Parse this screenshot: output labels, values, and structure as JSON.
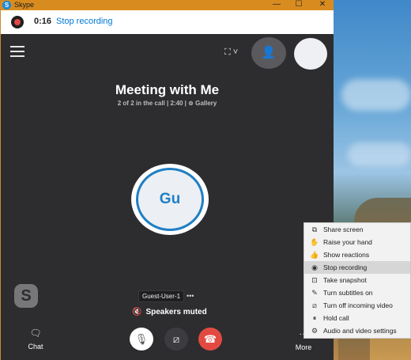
{
  "window": {
    "title": "Skype",
    "controls": [
      "—",
      "☐",
      "✕"
    ]
  },
  "recording": {
    "time": "0:16",
    "stop_label": "Stop recording"
  },
  "meeting": {
    "title": "Meeting with Me",
    "subtitle_prefix": "2 of 2 in the call | 2:40 | ",
    "view_label": "Gallery"
  },
  "participant": {
    "initials": "Gu",
    "name": "Guest-User-1",
    "more": "•••",
    "speakers_status": "Speakers muted"
  },
  "bottom_bar": {
    "chat_label": "Chat",
    "more_label": "More"
  },
  "context_menu": {
    "items": [
      {
        "label": "Share screen",
        "icon": "share-screen-icon",
        "glyph": "⧉"
      },
      {
        "label": "Raise your hand",
        "icon": "hand-icon",
        "glyph": "✋"
      },
      {
        "label": "Show reactions",
        "icon": "reactions-icon",
        "glyph": "👍"
      },
      {
        "label": "Stop recording",
        "icon": "record-icon",
        "glyph": "◉"
      },
      {
        "label": "Take snapshot",
        "icon": "snapshot-icon",
        "glyph": "⊡"
      },
      {
        "label": "Turn subtitles on",
        "icon": "subtitles-icon",
        "glyph": "✎"
      },
      {
        "label": "Turn off incoming video",
        "icon": "video-off-icon",
        "glyph": "⧄"
      },
      {
        "label": "Hold call",
        "icon": "hold-icon",
        "glyph": "⏸"
      },
      {
        "label": "Audio and video settings",
        "icon": "settings-icon",
        "glyph": "⚙"
      }
    ]
  },
  "colors": {
    "titlebar": "#d88c20",
    "accent": "#0078d4",
    "end_call": "#e24a41"
  }
}
